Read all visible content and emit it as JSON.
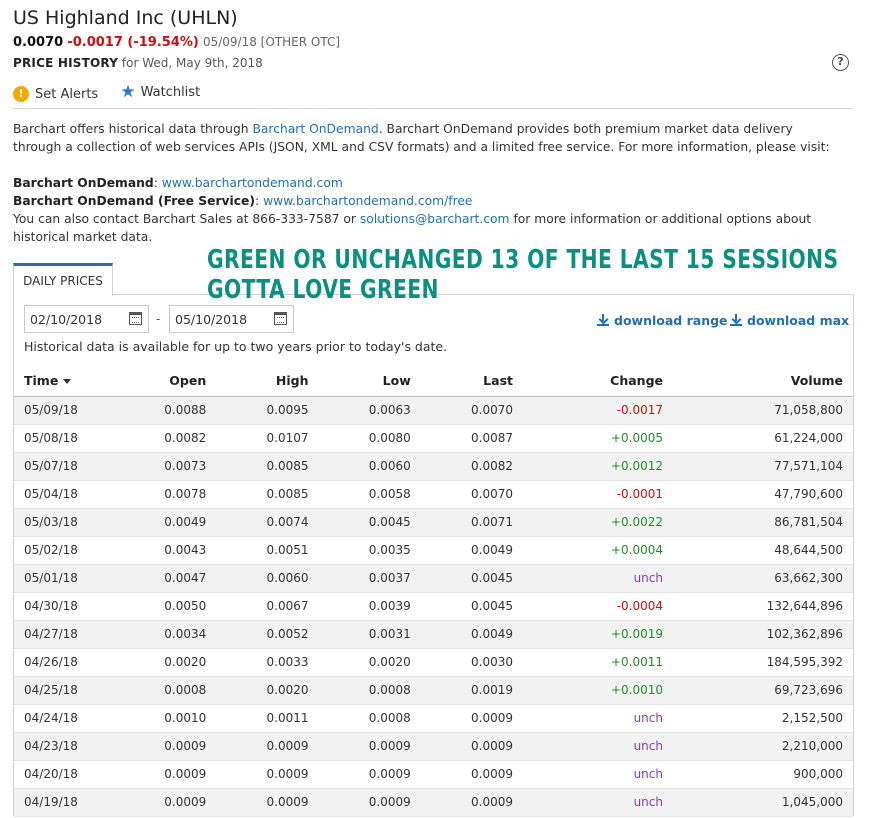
{
  "header": {
    "title": "US Highland Inc (UHLN)",
    "last": "0.0070",
    "change": "-0.0017 (-19.54%)",
    "meta": "05/09/18 [OTHER OTC]",
    "price_history_label": "PRICE HISTORY",
    "price_history_for": "for Wed, May 9th, 2018",
    "help_icon": "?"
  },
  "actions": {
    "alerts_label": "Set Alerts",
    "watchlist_label": "Watchlist"
  },
  "info": {
    "line1_pre": "Barchart offers historical data through ",
    "line1_link": "Barchart OnDemand",
    "line1_post": ". Barchart OnDemand provides both premium market data delivery",
    "line2": "through a collection of web services APIs (JSON, XML and CSV formats) and a limited free service. For more information, please visit:",
    "ondemand_label": "Barchart OnDemand",
    "ondemand_url": "www.barchartondemand.com",
    "free_label": "Barchart OnDemand (Free Service)",
    "free_url": "www.barchartondemand.com/free",
    "contact_pre": "You can also contact Barchart Sales at 866-333-7587 or ",
    "contact_email": "solutions@barchart.com",
    "contact_post": " for more information or additional options about",
    "contact_line2": "historical market data."
  },
  "overlay": {
    "line1": "GREEN OR UNCHANGED 13 OF THE LAST 15 SESSIONS",
    "line2": "GOTTA LOVE GREEN"
  },
  "tab": {
    "label": "DAILY PRICES"
  },
  "range": {
    "from": "02/10/2018",
    "to": "05/10/2018",
    "dash": "-",
    "download_range": "download range",
    "download_max": "download max",
    "note": "Historical data is available for up to two years prior to today's date."
  },
  "table": {
    "headers": {
      "time": "Time",
      "open": "Open",
      "high": "High",
      "low": "Low",
      "last": "Last",
      "change": "Change",
      "volume": "Volume"
    },
    "rows": [
      [
        "05/09/18",
        "0.0088",
        "0.0095",
        "0.0063",
        "0.0070",
        "-0.0017",
        "71,058,800"
      ],
      [
        "05/08/18",
        "0.0082",
        "0.0107",
        "0.0080",
        "0.0087",
        "+0.0005",
        "61,224,000"
      ],
      [
        "05/07/18",
        "0.0073",
        "0.0085",
        "0.0060",
        "0.0082",
        "+0.0012",
        "77,571,104"
      ],
      [
        "05/04/18",
        "0.0078",
        "0.0085",
        "0.0058",
        "0.0070",
        "-0.0001",
        "47,790,600"
      ],
      [
        "05/03/18",
        "0.0049",
        "0.0074",
        "0.0045",
        "0.0071",
        "+0.0022",
        "86,781,504"
      ],
      [
        "05/02/18",
        "0.0043",
        "0.0051",
        "0.0035",
        "0.0049",
        "+0.0004",
        "48,644,500"
      ],
      [
        "05/01/18",
        "0.0047",
        "0.0060",
        "0.0037",
        "0.0045",
        "unch",
        "63,662,300"
      ],
      [
        "04/30/18",
        "0.0050",
        "0.0067",
        "0.0039",
        "0.0045",
        "-0.0004",
        "132,644,896"
      ],
      [
        "04/27/18",
        "0.0034",
        "0.0052",
        "0.0031",
        "0.0049",
        "+0.0019",
        "102,362,896"
      ],
      [
        "04/26/18",
        "0.0020",
        "0.0033",
        "0.0020",
        "0.0030",
        "+0.0011",
        "184,595,392"
      ],
      [
        "04/25/18",
        "0.0008",
        "0.0020",
        "0.0008",
        "0.0019",
        "+0.0010",
        "69,723,696"
      ],
      [
        "04/24/18",
        "0.0010",
        "0.0011",
        "0.0008",
        "0.0009",
        "unch",
        "2,152,500"
      ],
      [
        "04/23/18",
        "0.0009",
        "0.0009",
        "0.0009",
        "0.0009",
        "unch",
        "2,210,000"
      ],
      [
        "04/20/18",
        "0.0009",
        "0.0009",
        "0.0009",
        "0.0009",
        "unch",
        "900,000"
      ],
      [
        "04/19/18",
        "0.0009",
        "0.0009",
        "0.0009",
        "0.0009",
        "unch",
        "1,045,000"
      ]
    ]
  },
  "colors": {
    "negative": "#d10c0c",
    "positive": "#1e8c2a",
    "unchanged": "#7d3fb3",
    "link": "#1f6fb5",
    "overlay": "#0b8f80"
  }
}
